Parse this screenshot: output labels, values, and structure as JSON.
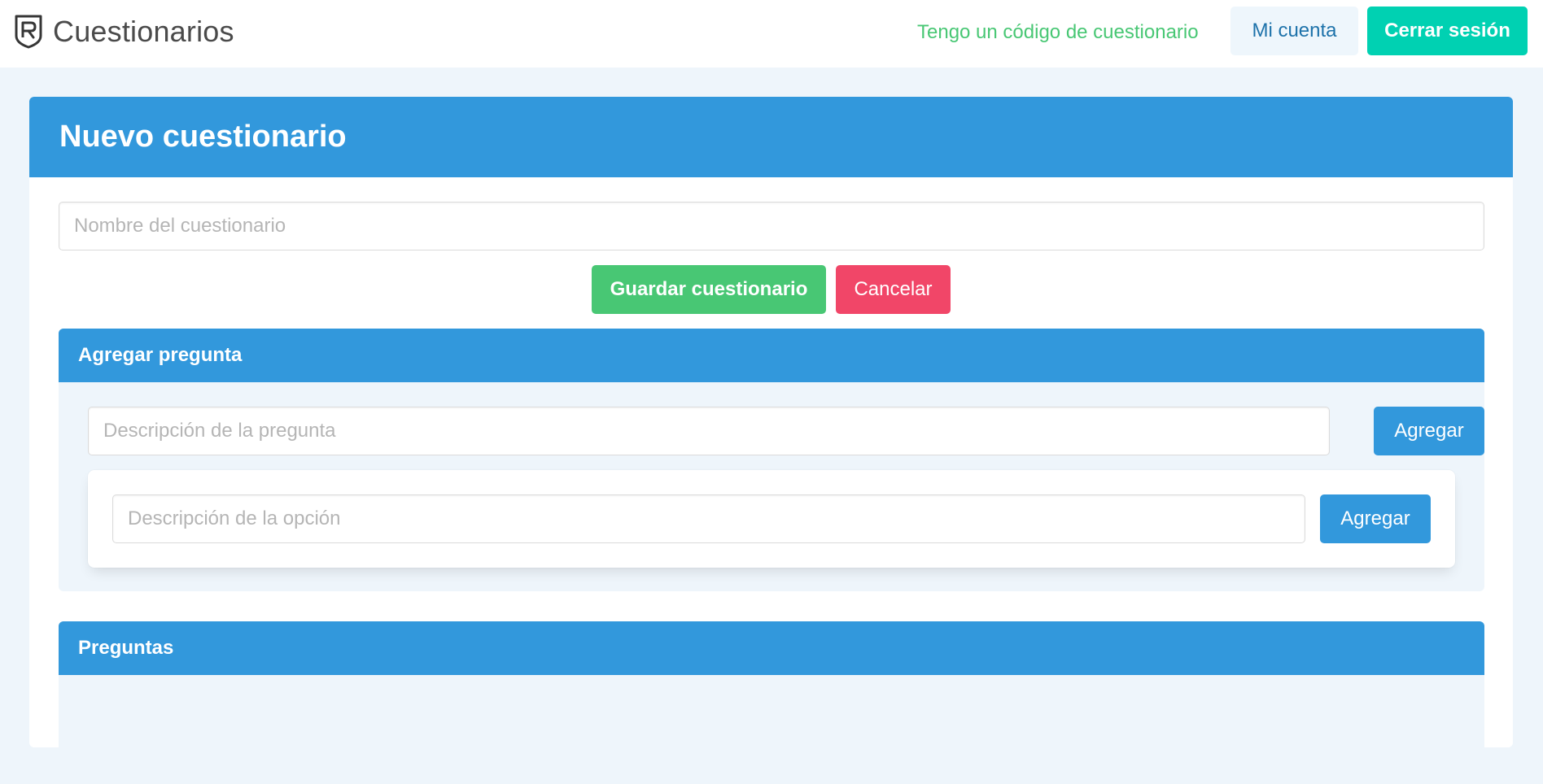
{
  "navbar": {
    "brand": {
      "icon": "shield-logo-icon",
      "title": "Cuestionarios"
    },
    "code_link": "Tengo un código de cuestionario",
    "account_button": "Mi cuenta",
    "logout_button": "Cerrar sesión"
  },
  "form": {
    "title": "Nuevo cuestionario",
    "name_input": {
      "value": "",
      "placeholder": "Nombre del cuestionario"
    },
    "save_button": "Guardar cuestionario",
    "cancel_button": "Cancelar"
  },
  "add_question": {
    "title": "Agregar pregunta",
    "question_input": {
      "value": "",
      "placeholder": "Descripción de la pregunta"
    },
    "add_question_button": "Agregar",
    "option_input": {
      "value": "",
      "placeholder": "Descripción de la opción"
    },
    "add_option_button": "Agregar"
  },
  "questions": {
    "title": "Preguntas",
    "items": []
  },
  "colors": {
    "primary": "#3298dc",
    "success": "#48c774",
    "danger": "#f14668",
    "turquoise": "#00d1b2",
    "light_info": "#eef6fc",
    "background": "#eef5fb"
  }
}
